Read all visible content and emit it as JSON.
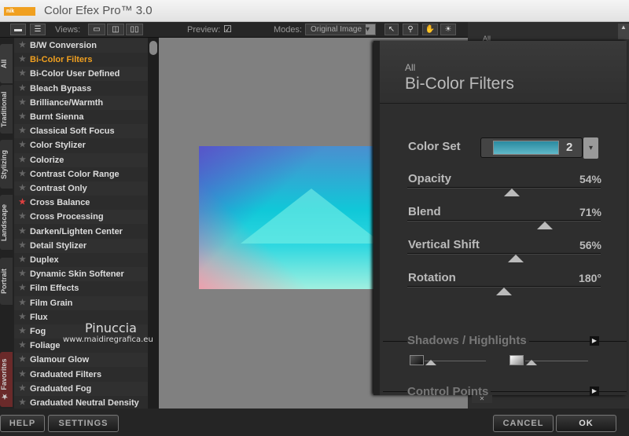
{
  "app": {
    "title": "Color Efex Pro™ 3.0",
    "logo_text": "nik software"
  },
  "toolbar": {
    "views_label": "Views:",
    "preview_label": "Preview:",
    "preview_checked": "☑",
    "modes_label": "Modes:",
    "mode_value": "Original Image"
  },
  "tabs": [
    "All",
    "Traditional",
    "Stylizing",
    "Landscape",
    "Portrait",
    "Favorites"
  ],
  "filters": [
    {
      "label": "B/W Conversion",
      "fav": false
    },
    {
      "label": "Bi-Color Filters",
      "fav": false,
      "selected": true
    },
    {
      "label": "Bi-Color User Defined",
      "fav": false
    },
    {
      "label": "Bleach Bypass",
      "fav": false
    },
    {
      "label": "Brilliance/Warmth",
      "fav": false
    },
    {
      "label": "Burnt Sienna",
      "fav": false
    },
    {
      "label": "Classical Soft Focus",
      "fav": false
    },
    {
      "label": "Color Stylizer",
      "fav": false
    },
    {
      "label": "Colorize",
      "fav": false
    },
    {
      "label": "Contrast Color Range",
      "fav": false
    },
    {
      "label": "Contrast Only",
      "fav": false
    },
    {
      "label": "Cross Balance",
      "fav": true
    },
    {
      "label": "Cross Processing",
      "fav": false
    },
    {
      "label": "Darken/Lighten Center",
      "fav": false
    },
    {
      "label": "Detail Stylizer",
      "fav": false
    },
    {
      "label": "Duplex",
      "fav": false
    },
    {
      "label": "Dynamic Skin Softener",
      "fav": false
    },
    {
      "label": "Film Effects",
      "fav": false
    },
    {
      "label": "Film Grain",
      "fav": false
    },
    {
      "label": "Flux",
      "fav": false
    },
    {
      "label": "Fog",
      "fav": false
    },
    {
      "label": "Foliage",
      "fav": false
    },
    {
      "label": "Glamour Glow",
      "fav": false
    },
    {
      "label": "Graduated Filters",
      "fav": false
    },
    {
      "label": "Graduated Fog",
      "fav": false
    },
    {
      "label": "Graduated Neutral Density",
      "fav": false
    }
  ],
  "watermark": {
    "name": "Pinuccia",
    "url": "www.maidiregrafica.eu"
  },
  "panel": {
    "breadcrumb": "All",
    "right_breadcrumb": "All",
    "title": "Bi-Color Filters",
    "color_set_label": "Color Set",
    "color_set_value": "2",
    "sliders": [
      {
        "label": "Opacity",
        "display": "54%",
        "fraction": 0.54
      },
      {
        "label": "Blend",
        "display": "71%",
        "fraction": 0.71
      },
      {
        "label": "Vertical Shift",
        "display": "56%",
        "fraction": 0.56
      },
      {
        "label": "Rotation",
        "display": "180°",
        "fraction": 0.5
      }
    ],
    "shadows_label": "Shadows / Highlights",
    "control_points_label": "Control Points"
  },
  "bottom": {
    "help": "HELP",
    "settings": "SETTINGS",
    "cancel": "CANCEL",
    "ok": "OK"
  },
  "colors": {
    "selected": "#f0a020",
    "fav_star": "#e04040"
  }
}
